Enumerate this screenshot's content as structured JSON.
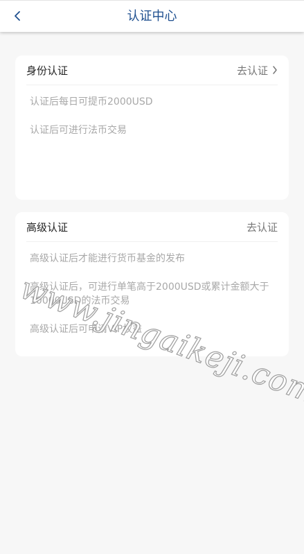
{
  "header": {
    "title": "认证中心"
  },
  "identity_card": {
    "title": "身份认证",
    "action": "去认证",
    "benefits": [
      "认证后每日可提币2000USD",
      "认证后可进行法币交易"
    ]
  },
  "advanced_card": {
    "title": "高级认证",
    "action": "去认证",
    "benefits": [
      "高级认证后才能进行货币基金的发布",
      "高级认证后，可进行单笔高于2000USD或累计金额大于10000USD的法币交易",
      "高级认证后可申请VIP权益"
    ]
  },
  "watermark": "www.jingaikeji.com",
  "colors": {
    "title": "#1e4f8f",
    "background": "#f7f7f7",
    "card": "#ffffff",
    "benefit_text": "#a8a8a8"
  }
}
